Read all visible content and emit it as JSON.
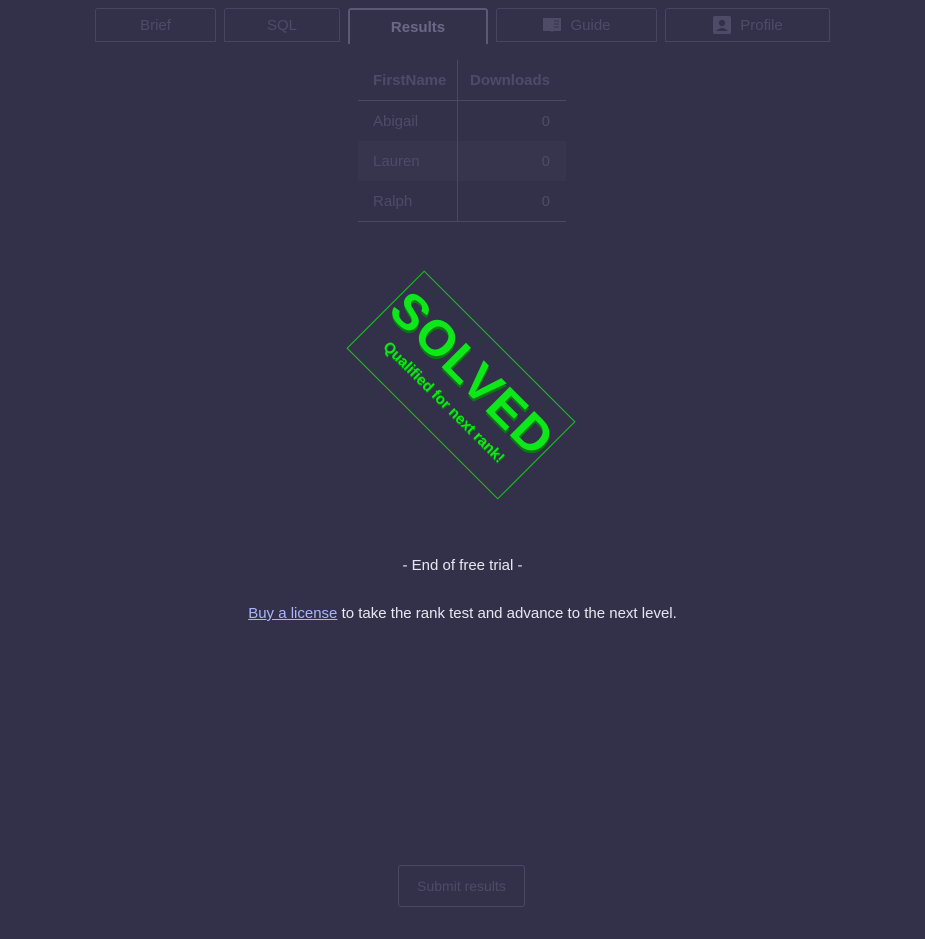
{
  "tabs": [
    {
      "label": "Brief",
      "icon": null
    },
    {
      "label": "SQL",
      "icon": null
    },
    {
      "label": "Results",
      "icon": null,
      "active": true
    },
    {
      "label": "Guide",
      "icon": "book-icon"
    },
    {
      "label": "Profile",
      "icon": "profile-icon"
    }
  ],
  "table": {
    "columns": [
      "FirstName",
      "Downloads"
    ],
    "rows": [
      [
        "Abigail",
        "0"
      ],
      [
        "Lauren",
        "0"
      ],
      [
        "Ralph",
        "0"
      ]
    ]
  },
  "stamp": {
    "title": "SOLVED",
    "subtitle": "Qualified for next rank!",
    "color": "#0ee81a"
  },
  "trial": {
    "end_text": "- End of free trial -",
    "link_text": "Buy a license",
    "rest_text": " to take the rank test and advance to the next level."
  },
  "submit": {
    "label": "Submit results"
  },
  "colors": {
    "background": "#33314a",
    "link": "#a9b4ff",
    "stamp_green": "#0ee81a"
  }
}
